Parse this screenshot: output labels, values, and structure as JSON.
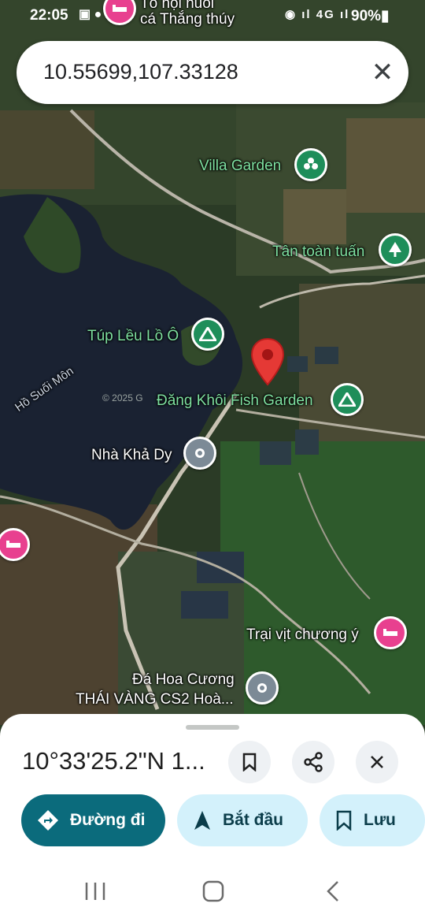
{
  "status_bar": {
    "time": "22:05",
    "battery": "90%",
    "network": "4G"
  },
  "search": {
    "query": "10.55699,107.33128",
    "clear_icon": "close-icon"
  },
  "map_labels": {
    "top_place_line1": "Tổ hội nuôi",
    "top_place_line2": "cá Thắng thúy",
    "villa_garden": "Villa Garden",
    "tan_toan_tuan": "Tân toàn tuấn",
    "tup_leu": "Túp Lều Lồ Ô",
    "lake": "Hồ Suối Môn",
    "dang_khoi": "Đăng Khôi Fish Garden",
    "nha_kha_dy": "Nhà Khả Dy",
    "trai_vit": "Trại vịt chương ý",
    "da_hoa_cuong": "Đá Hoa Cương",
    "thai_vang": "THÁI VÀNG CS2 Hoà...",
    "watermark": "© 2025 G"
  },
  "colors": {
    "pin_red": "#e53935",
    "campground_green": "#1e8e5a",
    "hotel_pink": "#e8408f",
    "poi_gray": "#7c8a96",
    "primary_teal": "#0b6b7c",
    "secondary_pill": "#d3f1fb"
  },
  "sheet": {
    "coordinates": "10°33'25.2\"N 1...",
    "directions_label": "Đường đi",
    "start_label": "Bắt đầu",
    "save_label": "Lưu"
  }
}
